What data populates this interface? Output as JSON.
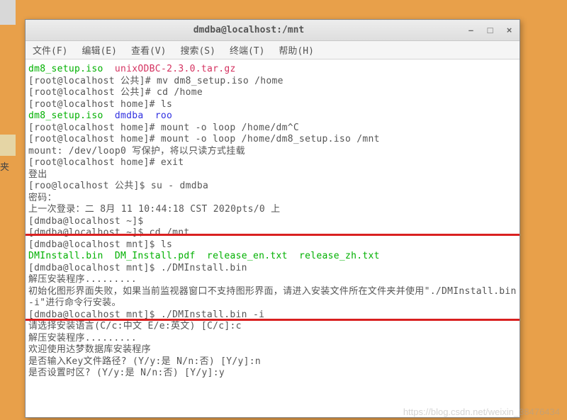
{
  "desktop": {
    "folder_label": "夹"
  },
  "window": {
    "title": "dmdba@localhost:/mnt",
    "buttons": {
      "min": "–",
      "max": "□",
      "close": "×"
    }
  },
  "menu": {
    "file": "文件(F)",
    "edit": "编辑(E)",
    "view": "查看(V)",
    "search": "搜索(S)",
    "terminal": "终端(T)",
    "help": "帮助(H)"
  },
  "term": {
    "l01a": "dm8_setup.iso",
    "l01b": "  unixODBC",
    "l01c": "-2.3.0.",
    "l01d": "tar.gz",
    "l02": "[root@localhost 公共]# mv dm8_setup.iso /home",
    "l03": "[root@localhost 公共]# cd /home",
    "l04": "[root@localhost home]# ls",
    "l05a": "dm8_setup.iso",
    "l05b": "  dmdba  roo",
    "l06": "[root@localhost home]# mount -o loop /home/dm^C",
    "l07": "[root@localhost home]# mount -o loop /home/dm8_setup.iso /mnt",
    "l08": "mount: /dev/loop0 写保护，将以只读方式挂载",
    "l09": "[root@localhost home]# exit",
    "l10": "登出",
    "l11": "[roo@localhost 公共]$ su - dmdba",
    "l12": "密码：",
    "l13": "上一次登录：二 8月 11 10:44:18 CST 2020pts/0 上",
    "l14": "[dmdba@localhost ~]$ ",
    "l15": "[dmdba@localhost ~]$ cd /mnt",
    "l16": "[dmdba@localhost mnt]$ ls",
    "l17a": "DMInstall.bin",
    "l17b": "  DM_Install.pdf  release_en.txt  release_zh.txt",
    "l18": "[dmdba@localhost mnt]$ ./DMInstall.bin",
    "l19": "解压安装程序.........",
    "l20": "初始化图形界面失败，如果当前监视器窗口不支持图形界面，请进入安装文件所在文件夹并使用\"./DMInstall.bin -i\"进行命令行安装。",
    "l21": "[dmdba@localhost mnt]$ ./DMInstall.bin -i",
    "l22": "请选择安装语言(C/c:中文 E/e:英文) [C/c]:c",
    "l23": "解压安装程序.........",
    "l24": "欢迎使用达梦数据库安装程序",
    "l25": "",
    "l26": "是否输入Key文件路径? (Y/y:是 N/n:否) [Y/y]:n",
    "l27": "",
    "l28": "是否设置时区? (Y/y:是 N/n:否) [Y/y]:y"
  },
  "watermark": "https://blog.csdn.net/weixin_38476434"
}
